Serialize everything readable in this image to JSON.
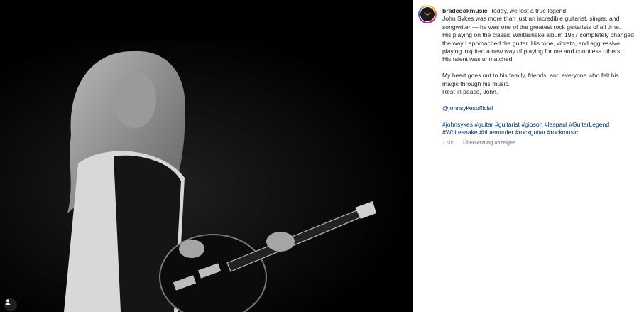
{
  "post": {
    "username": "bradcookmusic",
    "caption_lines": {
      "l1": "Today, we lost a true legend.",
      "l2": "John Sykes was more than just an incredible guitarist, singer, and songwriter — he was one of the greatest rock guitarists of all time.",
      "l3": "His playing on the classic Whitesnake album 1987 completely changed the way I approached the guitar. His tone, vibrato, and aggressive playing inspired a new way of playing for me and countless others.",
      "l4": "His talent was unmatched.",
      "l5": "My heart goes out to his family, friends, and everyone who felt his magic through his music.",
      "l6": "Rest in peace, John."
    },
    "mention": "@johnsykesofficial",
    "hashtags": [
      "#johnsykes",
      "#guitar",
      "#guitarist",
      "#gibson",
      "#lespaul",
      "#GuitarLegend",
      "#Whitesnake",
      "#bluemurder",
      "#rockguitar",
      "#rockmusic"
    ],
    "time_ago": "7 Min.",
    "translate_label": "Übersetzung anzeigen"
  },
  "icons": {
    "tagged_user": "person-icon",
    "avatar": "avatar-logo-icon"
  },
  "colors": {
    "link": "#00376b",
    "text": "#262626",
    "muted": "#8e8e8e"
  }
}
